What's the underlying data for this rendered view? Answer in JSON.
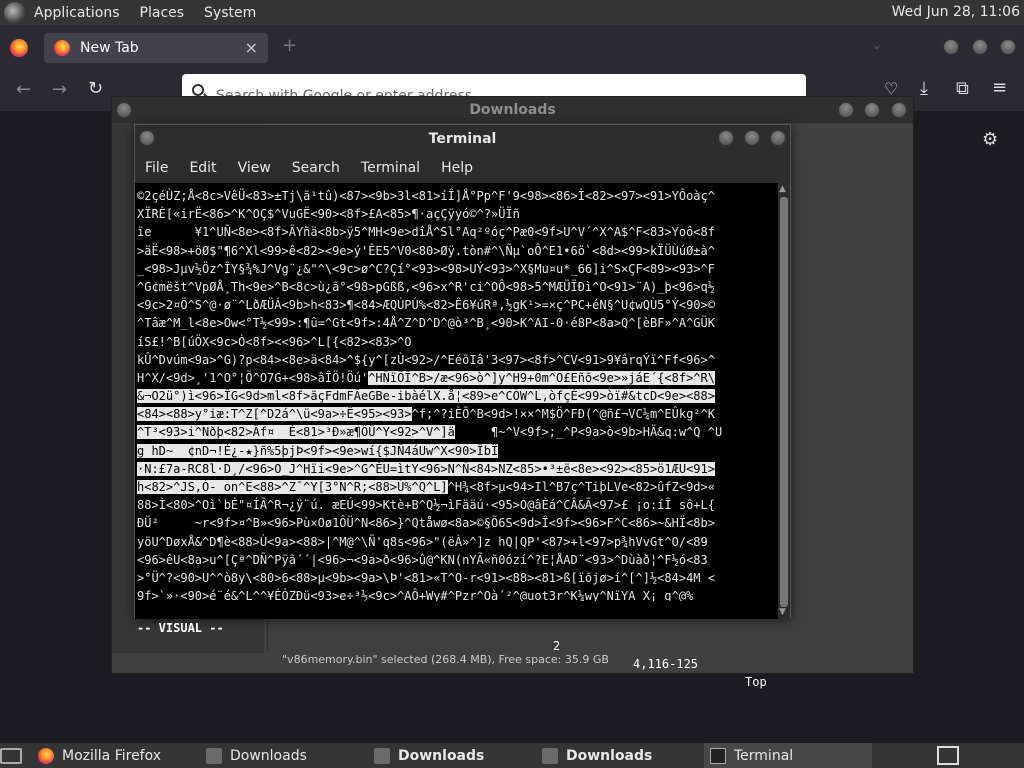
{
  "top_panel": {
    "menus": [
      "Applications",
      "Places",
      "System"
    ],
    "clock": "Wed Jun 28, 11:06"
  },
  "firefox": {
    "tab_title": "New Tab",
    "tab_close": "×",
    "new_tab": "+",
    "url_placeholder": "Search with Google or enter address"
  },
  "downloads_window": {
    "title": "Downloads",
    "status": "\"v86memory.bin\" selected (268.4 MB), Free space: 35.9 GB"
  },
  "terminal": {
    "title": "Terminal",
    "menu": [
      "File",
      "Edit",
      "View",
      "Search",
      "Terminal",
      "Help"
    ],
    "lines": [
      {
        "pre": "©2çéÙZ;Å<8c>VêÜ<83>±Tj\\ã¹tû)<87><9b>3l<81>íÎ]Å°Pp^F'9<98><86>Ì<82><97><91>YÕoàç^",
        "hl": "",
        "post": ""
      },
      {
        "pre": "XÏRÈ[«irË<86>^K^OÇ$^VuGË<90><8f>£A<85>¶·açÇÿyó©^?»ÜÏñ",
        "hl": "",
        "post": ""
      },
      {
        "pre": "ïe      ¥1^UÑ<8e><8f>ÄYñä<8b>ÿ5^MH<9e>dîÅ^Sl°Aq²ºóç^Pæ0<9f>U^V´^X^A$^F<83>Yoô<8f",
        "hl": "",
        "post": ""
      },
      {
        "pre": ">äË<98>+öØ$\"¶6^Xl<99>ê<82><9e>ý'ÊE5^V0<80>Øÿ.tòn#^\\Ñµ`oÔ^E1•6ö`<8d><99>kÏÜÙúØ±à^",
        "hl": "",
        "post": ""
      },
      {
        "pre": "_<98>Jµv½Öz^ÎY§¾%J^Vg¨¿&\"^\\<9c>ø^C?Çí°<93><98>UÝ<93>^X§Mu¤u*_66]i^S×ÇF<89><93>^F",
        "hl": "",
        "post": ""
      },
      {
        "pre": "^G¢mëšt^VpØÅ¸Th<9e>^B<8c>ù¿ã°<98>pGßß,<96>x^R'ci^OÔ<98>5^MÆÜÏÐì^O<91>¨A)_þ<96>q½",
        "hl": "",
        "post": ""
      },
      {
        "pre": "<9c>2¤Ö^S^@·ø¨^LðÆÜÁ<9b>h<83>¶<84>ÆQÙPÚ%<82>Ê6¥úRª,½gK¹>=×ç^PC+éN§^U¢wQÙ5°Ý<90>©",
        "hl": "",
        "post": ""
      },
      {
        "pre": "^Tâæ^M_l<8e>Ow<°T½<99>:¶û=^Gt<9f>:4Å^Z^D^D^@ò³^B¸<90>K^AI-0·é8P<8a>Q^[èBF»^A^GÜK",
        "hl": "",
        "post": ""
      },
      {
        "pre": "íS£!^B[úÖX<9c>Ò<8f><<96>^L[{<82><83>^O",
        "hl": "",
        "post": ""
      },
      {
        "pre": "kÛ^Dvúm<9a>^G)?p<84><8e>ä<84>^${y^[zÙ<92>/^EéõIâ'3<97><8f>^CV<91>9¥ârqÝï^Ff<96>^",
        "hl": "",
        "post": ""
      },
      {
        "pre": "H^X/<9d>¸'1^O°¦Õ^O7G+<98>âÎÖ!Öú'",
        "hl": "^HÑïÕÎ^B>/æ<96>ò^]y^H9+0m^O£Eñõ<9e>»jáE´{<8f>^R\\",
        "post": ""
      },
      {
        "pre": "",
        "hl": "&¬O2ü°)ì<96>ÎG<9d>ml<8f>ãçFdmFÃeGBe-ibàélX.å¦<89>e^CÓW^L,òfçÉ<99>òï#&tcD<9e><88>",
        "post": ""
      },
      {
        "pre": "",
        "hl": "<84><88>y°iæ:T^Z[^D2á^\\ü<9a>÷Ë<95><93>",
        "post": "^f;^?iÈÕ^B<9d>!××^M$Ö^FÐ(^@ñ£¬VC¼m^EÛkg²^K"
      },
      {
        "pre": "",
        "hl": "^T³<93>i^Nðþ<82>Äf¤  É<81>³Ð»æ¶ÖÜ^Y<92>^V^]ä",
        "post": "     ¶~^V<9f>;_^P<9a>ò<9b>HÄ&q:w^Q ^U"
      },
      {
        "pre": "",
        "hl": "g hD~  ¢nD¬!È¿-★}ñ%5þjÞ<9f><9e>wí{$JÑ4áUw^X<90>ÏbÏ",
        "post": ""
      },
      {
        "pre": "",
        "hl": "·N:£7a-RC8l·D¸/<96>O_J^Hïi<9e>^G^ÉU=ìtY<96>N^Ñ<84>NZ<85>•³±ë<8e><92><85>ö1ÆU<91>",
        "post": ""
      },
      {
        "pre": "",
        "hl": "h<82>^JS,Ó- on^E<88>^Z¯^Y[3°N^R;<88>Ù%^Q^L]",
        "post": "^H¾<8f>µ<94>Il^B7ç^TiþLVe<82>ûfZ<9d>«"
      },
      {
        "pre": "88>Ì<80>^Oì`bÉ\"¤ÍÃ^R¬¿ÿ¨ú. æEÚ<99>Ktè+B^Q½¬ìFääú·<95>O@âÈá^CÂ&Ã<97>£ ¡o:íÎ sô+L{",
        "hl": "",
        "post": ""
      },
      {
        "pre": "ÐÜ²     ~r<9f>¤^B»<96>Pù×Oø1ÔÜ^N<86>}^Qtåwø<8a>©§Õ6S<9d>Î<9f><96>F^C<86>~&HÏ<8b>",
        "hl": "",
        "post": ""
      },
      {
        "pre": "yöU^DøxÅ&^D¶è<88>Ù<9a><88>|^M@^\\Ñ'q8s<96>\"(ëÀ»^]z hQ|QP'<87>+l<97>p¾hVvGt^O/<89",
        "hl": "",
        "post": ""
      },
      {
        "pre": "<96>êU<8a>u^[Çª^DÑ^Pÿã´´|<96>¬<9a>ð<96>û@^KN(nYÃ«ñ0ózí^?E¦ÅAD¨<93>^Dùàð¦^F½ó<83",
        "hl": "",
        "post": ""
      },
      {
        "pre": ">°Ü^?<90>U^^ò8y\\<80>6<88>µ<9b><9a>\\Þ'<81>«T^O-r<91><88><81>ß[ïõjø>í^[^]½<84>4M <",
        "hl": "",
        "post": ""
      },
      {
        "pre": "9f>`»·<90>é¨é&^L^^¥ÉÓZÐü<93>e÷³½<9c>^AÔ+Wy#^Pzr^Oà´²^@uot3r^K¼wy^NïYA X¡ g^@%",
        "hl": "",
        "post": ""
      }
    ],
    "status": {
      "mode": "-- VISUAL --",
      "count": "2",
      "position": "4,116-125",
      "percent": "Top"
    }
  },
  "taskbar": {
    "items": [
      {
        "label": "Mozilla Firefox",
        "bold": false,
        "active": false
      },
      {
        "label": "Downloads",
        "bold": false,
        "active": false
      },
      {
        "label": "Downloads",
        "bold": true,
        "active": false
      },
      {
        "label": "Downloads",
        "bold": true,
        "active": false
      },
      {
        "label": "Terminal",
        "bold": false,
        "active": true
      }
    ]
  }
}
